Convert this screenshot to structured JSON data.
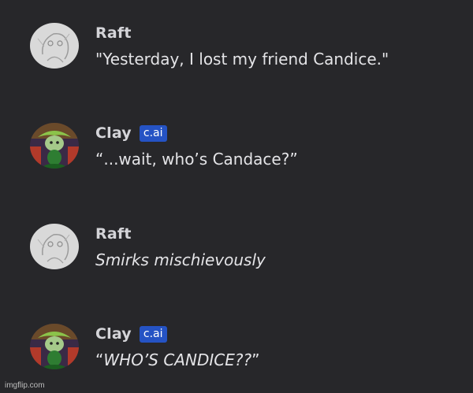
{
  "colors": {
    "background": "#27272a",
    "name_text": "#d4d4d8",
    "message_text": "#e4e4e7",
    "badge_bg": "#2553c4",
    "badge_text": "#ffffff"
  },
  "messages": [
    {
      "author": "Raft",
      "avatar_icon": "sketch-avatar-icon",
      "badge": null,
      "text": "\"Yesterday, I lost my friend Candice.\"",
      "italic": false
    },
    {
      "author": "Clay",
      "avatar_icon": "green-character-avatar-icon",
      "badge": "c.ai",
      "text": "“...wait, who’s Candace?”",
      "italic": false
    },
    {
      "author": "Raft",
      "avatar_icon": "sketch-avatar-icon",
      "badge": null,
      "text": "Smirks mischievously",
      "italic": true
    },
    {
      "author": "Clay",
      "avatar_icon": "green-character-avatar-icon",
      "badge": "c.ai",
      "text_prefix": "“",
      "text_italic": "WHO’S CANDICE??",
      "text_suffix": "”",
      "italic": "partial"
    }
  ],
  "watermark": "imgflip.com"
}
